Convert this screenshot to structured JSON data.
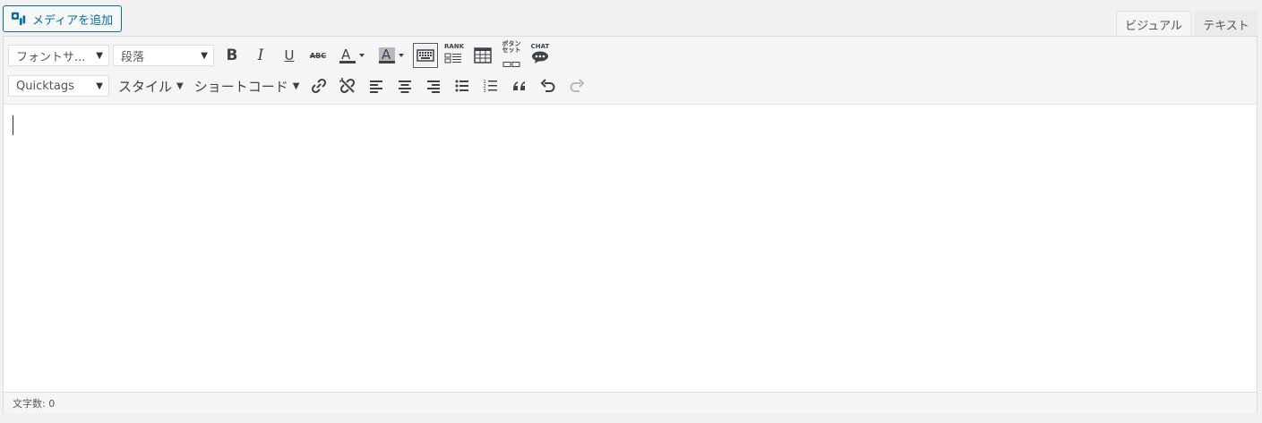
{
  "media_button": {
    "label": "メディアを追加"
  },
  "tabs": {
    "visual": "ビジュアル",
    "text": "テキスト"
  },
  "toolbar": {
    "row1": {
      "font_size_select": "フォントサ...",
      "format_select": "段落",
      "rank_label": "RANK",
      "button_set_label_1": "ボタン",
      "button_set_label_2": "セット",
      "chat_label": "CHAT"
    },
    "row2": {
      "quicktags_select": "Quicktags",
      "style_menu": "スタイル",
      "shortcode_menu": "ショートコード"
    }
  },
  "status": {
    "char_count": "文字数: 0"
  }
}
